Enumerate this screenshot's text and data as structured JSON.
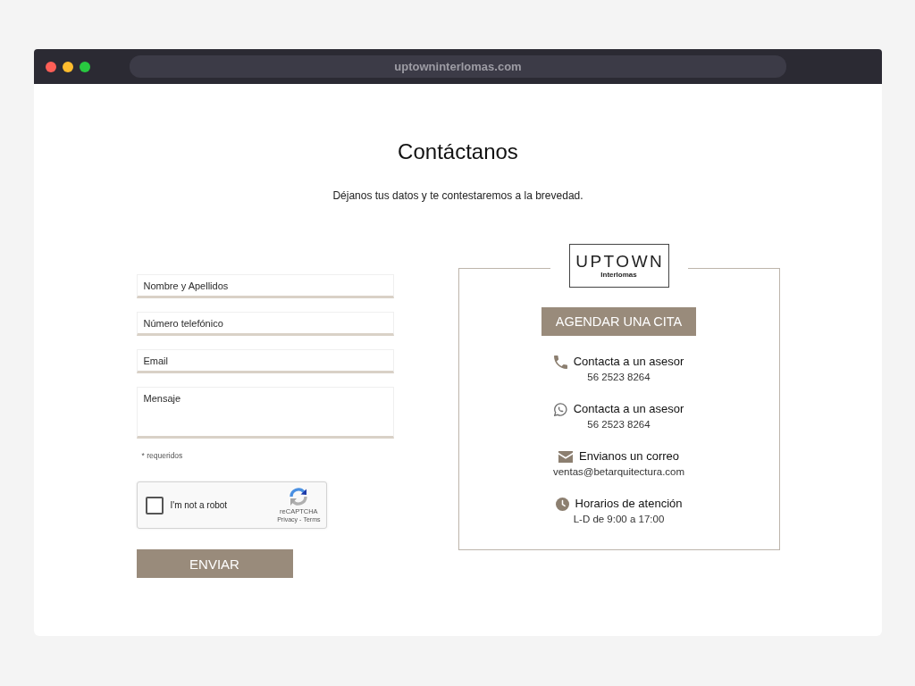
{
  "browser": {
    "window_controls": [
      {
        "kind": "close"
      },
      {
        "kind": "minimize"
      },
      {
        "kind": "maximize"
      }
    ],
    "url": "uptowninterlomas.com"
  },
  "heading": "Contáctanos",
  "subtitle": "Déjanos tus datos y te contestaremos a la brevedad.",
  "form": {
    "fields": [
      {
        "kind": "input",
        "placeholder": "Nombre y Apellidos"
      },
      {
        "kind": "input",
        "placeholder": "Número telefónico"
      },
      {
        "kind": "input",
        "placeholder": "Email"
      },
      {
        "kind": "textarea",
        "placeholder": "Mensaje"
      }
    ],
    "required_note": "* requeridos",
    "captcha": {
      "label": "I'm not a robot",
      "checked": false,
      "brand": "reCAPTCHA",
      "links": [
        "Privacy",
        "Terms"
      ],
      "separator": "-"
    },
    "submit": "ENVIAR"
  },
  "contact_card": {
    "logo": {
      "title": "UPTOWN",
      "subtitle": "Interlomas"
    },
    "button": "AGENDAR UNA CITA",
    "items": [
      {
        "kind": "phone",
        "title": "Contacta a un asesor",
        "value": "56 2523 8264"
      },
      {
        "kind": "whatsapp",
        "title": "Contacta a un asesor",
        "value": "56 2523 8264"
      },
      {
        "kind": "email",
        "title": "Envianos un correo",
        "value": "ventas@betarquitectura.com"
      },
      {
        "kind": "clock",
        "title": "Horarios de atención",
        "value": "L-D de 9:00 a 17:00"
      }
    ]
  }
}
